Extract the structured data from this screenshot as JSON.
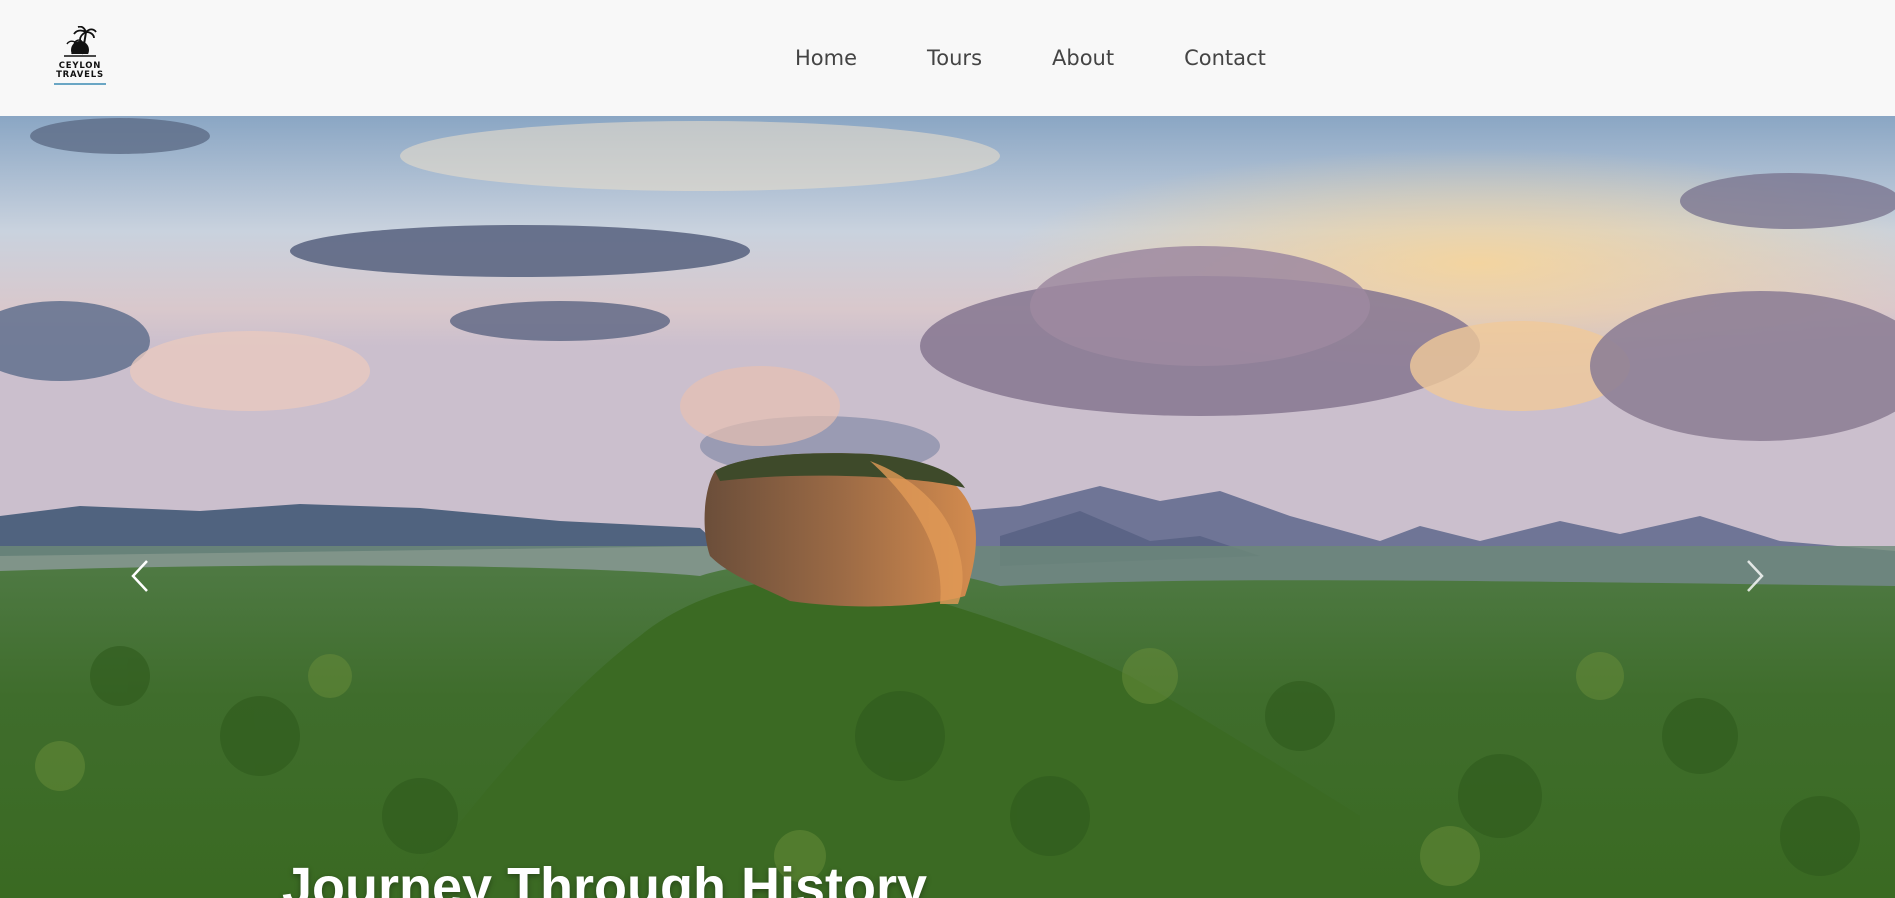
{
  "header": {
    "logo": {
      "line1": "CEYLON",
      "line2": "TRAVELS",
      "icon": "palm-tree-sunset-icon"
    },
    "nav": [
      {
        "label": "Home"
      },
      {
        "label": "Tours"
      },
      {
        "label": "About"
      },
      {
        "label": "Contact"
      }
    ]
  },
  "hero": {
    "title": "Journey Through History",
    "image": "sigiriya-rock-landscape",
    "prev_icon": "chevron-left-icon",
    "next_icon": "chevron-right-icon"
  },
  "colors": {
    "header_bg": "#f8f8f8",
    "nav_text": "#444444",
    "logo_accent": "#6aa6c4",
    "hero_title": "#ffffff"
  }
}
